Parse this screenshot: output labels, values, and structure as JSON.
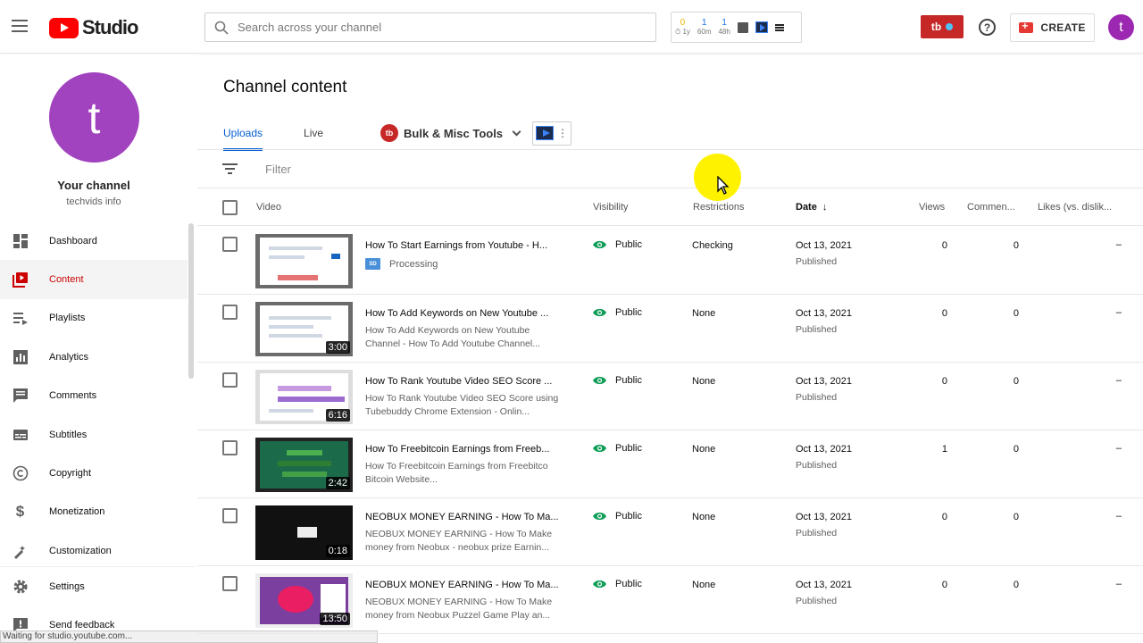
{
  "header": {
    "logo_text": "Studio",
    "search_placeholder": "Search across your channel",
    "tb_stats": [
      {
        "value": "0",
        "label": "⏱ 1y"
      },
      {
        "value": "1",
        "label": "60m"
      },
      {
        "value": "1",
        "label": "48h"
      }
    ],
    "tb_badge": "tb",
    "help": "?",
    "create_label": "CREATE",
    "avatar_letter": "t"
  },
  "sidebar": {
    "avatar_letter": "t",
    "channel_title": "Your channel",
    "channel_name": "techvids info",
    "items": [
      {
        "label": "Dashboard",
        "icon": "dashboard-icon"
      },
      {
        "label": "Content",
        "icon": "content-icon",
        "active": true
      },
      {
        "label": "Playlists",
        "icon": "playlists-icon"
      },
      {
        "label": "Analytics",
        "icon": "analytics-icon"
      },
      {
        "label": "Comments",
        "icon": "comments-icon"
      },
      {
        "label": "Subtitles",
        "icon": "subtitles-icon"
      },
      {
        "label": "Copyright",
        "icon": "copyright-icon"
      },
      {
        "label": "Monetization",
        "icon": "monetization-icon"
      },
      {
        "label": "Customization",
        "icon": "customization-icon"
      }
    ],
    "bottom_items": [
      {
        "label": "Settings",
        "icon": "gear-icon"
      },
      {
        "label": "Send feedback",
        "icon": "feedback-icon"
      }
    ]
  },
  "status_bar": "Waiting for studio.youtube.com...",
  "main": {
    "title": "Channel content",
    "tabs": [
      {
        "label": "Uploads",
        "active": true
      },
      {
        "label": "Live"
      }
    ],
    "bulk_tools": "Bulk & Misc Tools",
    "ext_dots": "⋮",
    "filter_placeholder": "Filter",
    "columns": {
      "video": "Video",
      "visibility": "Visibility",
      "restrictions": "Restrictions",
      "date": "Date",
      "views": "Views",
      "comments": "Commen...",
      "likes": "Likes (vs. dislik..."
    },
    "rows": [
      {
        "title": "How To Start Earnings from Youtube - H...",
        "desc": "",
        "processing": "Processing",
        "duration": "",
        "visibility": "Public",
        "restrictions": "Checking",
        "date": "Oct 13, 2021",
        "date_sub": "Published",
        "views": "0",
        "comments": "0",
        "likes": "–"
      },
      {
        "title": "How To Add Keywords on New Youtube ...",
        "desc": "How To Add Keywords on New Youtube Channel - How To Add Youtube Channel...",
        "processing": "",
        "duration": "3:00",
        "visibility": "Public",
        "restrictions": "None",
        "date": "Oct 13, 2021",
        "date_sub": "Published",
        "views": "0",
        "comments": "0",
        "likes": "–"
      },
      {
        "title": "How To Rank Youtube Video SEO Score ...",
        "desc": "How To Rank Youtube Video SEO Score using Tubebuddy Chrome Extension - Onlin...",
        "processing": "",
        "duration": "6:16",
        "visibility": "Public",
        "restrictions": "None",
        "date": "Oct 13, 2021",
        "date_sub": "Published",
        "views": "0",
        "comments": "0",
        "likes": "–"
      },
      {
        "title": "How To Freebitcoin Earnings from Freeb...",
        "desc": "How To Freebitcoin Earnings from Freebitco Bitcoin Website...",
        "processing": "",
        "duration": "2:42",
        "visibility": "Public",
        "restrictions": "None",
        "date": "Oct 13, 2021",
        "date_sub": "Published",
        "views": "1",
        "comments": "0",
        "likes": "–"
      },
      {
        "title": "NEOBUX MONEY EARNING - How To Ma...",
        "desc": "NEOBUX MONEY EARNING - How To Make money from Neobux - neobux prize Earnin...",
        "processing": "",
        "duration": "0:18",
        "visibility": "Public",
        "restrictions": "None",
        "date": "Oct 13, 2021",
        "date_sub": "Published",
        "views": "0",
        "comments": "0",
        "likes": "–"
      },
      {
        "title": "NEOBUX MONEY EARNING - How To Ma...",
        "desc": "NEOBUX MONEY EARNING - How To Make money from Neobux Puzzel Game Play an...",
        "processing": "",
        "duration": "13:50",
        "visibility": "Public",
        "restrictions": "None",
        "date": "Oct 13, 2021",
        "date_sub": "Published",
        "views": "0",
        "comments": "0",
        "likes": "–"
      }
    ]
  },
  "colors": {
    "brand_red": "#ff0000",
    "accent_blue": "#065fd4",
    "public_green": "#0f9d58",
    "avatar_purple": "#a142bf"
  }
}
